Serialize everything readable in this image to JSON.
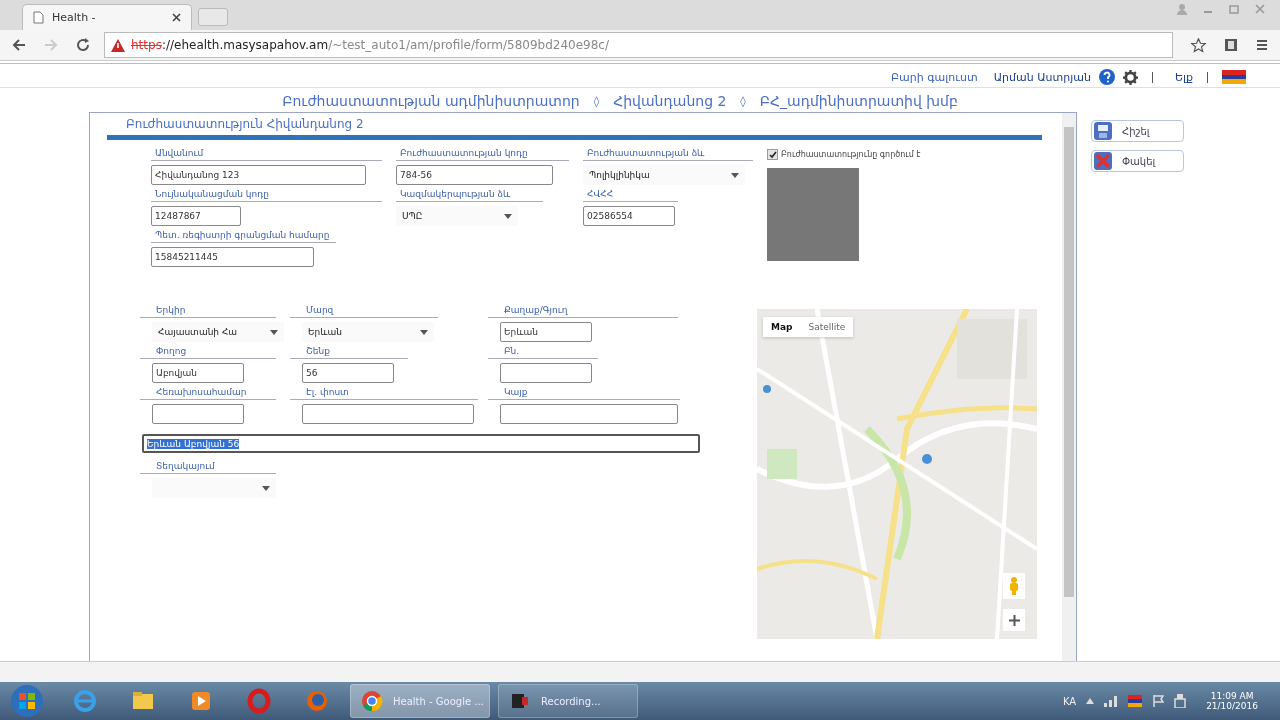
{
  "browser": {
    "tab_title": "Health -",
    "url_scheme": "https",
    "url_rest": "://ehealth.masysapahov.am",
    "url_path": "/~test_auto1/am/profile/form/5809bd240e98c/"
  },
  "header": {
    "greeting": "Բարի գալուստ",
    "user_name": "Արման Աստրյան",
    "logout": "Ելք"
  },
  "breadcrumb": [
    "Բուժհաստատության ադմինիստրատոր",
    "Հիվանդանոց 2",
    "ԲՀ_ադմինիստրատիվ խմբ"
  ],
  "breadcrumb_separator": "◊",
  "panel": {
    "title": "Բուժհաստատություն Հիվանդանոց 2",
    "details": [
      {
        "label": "Անվանում",
        "kind": "text",
        "value": "Հիվանդանոց 123"
      },
      {
        "label": "Բուժհաստատության կոդը",
        "kind": "text",
        "value": "784-56"
      },
      {
        "label": "Բուժհաստատության ձև",
        "kind": "select",
        "value": "Պոլիկլինիկա"
      },
      {
        "label": "Նույնականացման կոդը",
        "kind": "text",
        "value": "12487867"
      },
      {
        "label": "Կազմակերպության ձև",
        "kind": "select",
        "value": "ՍՊԸ"
      },
      {
        "label": "ՀՎՀՀ",
        "kind": "text",
        "value": "02586554"
      },
      {
        "label": "Պետ. ռեգիստրի գրանցման համարը",
        "kind": "text",
        "value": "15845211445"
      }
    ],
    "operating": {
      "label": "Բուժհաստատությունը գործում է",
      "checked": true
    },
    "address": [
      {
        "label": "Երկիր",
        "kind": "select",
        "value": "Հայաստանի Հա"
      },
      {
        "label": "Մարզ",
        "kind": "select",
        "value": "Երևան"
      },
      {
        "label": "Քաղաք/Գյուղ",
        "kind": "text",
        "value": "Երևան"
      },
      {
        "label": "Փողոց",
        "kind": "text",
        "value": "Աբովյան"
      },
      {
        "label": "Շենք",
        "kind": "text",
        "value": "56"
      },
      {
        "label": "Բն.",
        "kind": "text"
      },
      {
        "label": "Հեռախոսահամար",
        "kind": "text"
      },
      {
        "label": "Էլ. փոստ",
        "kind": "text"
      },
      {
        "label": "Կայք",
        "kind": "text"
      }
    ],
    "address_line": {
      "value": "Երևան Աբովյան 56",
      "selected": true
    },
    "location": {
      "label": "Տեղակայում",
      "kind": "select"
    },
    "map_types": [
      {
        "label": "Map",
        "selected": true
      },
      {
        "label": "Satellite",
        "selected": false
      }
    ]
  },
  "actions": [
    {
      "label": "Հիշել",
      "kind": "save"
    },
    {
      "label": "Փակել",
      "kind": "close"
    }
  ],
  "taskbar": {
    "apps": [
      {
        "kind": "ie"
      },
      {
        "kind": "folder"
      },
      {
        "kind": "media"
      },
      {
        "kind": "opera"
      },
      {
        "kind": "firefox"
      },
      {
        "kind": "chrome",
        "label": "Health - Google ...",
        "selected": true
      },
      {
        "kind": "recorder",
        "label": "Recording...",
        "selected": false
      }
    ],
    "language": "KA",
    "time": "11:09 AM",
    "date": "21/10/2016"
  }
}
